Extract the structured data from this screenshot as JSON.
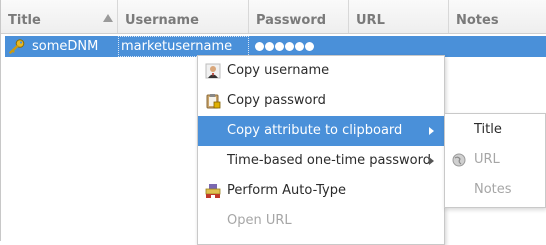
{
  "table": {
    "columns": [
      "Title",
      "Username",
      "Password",
      "URL",
      "Notes"
    ],
    "sort_column": "Title",
    "rows": [
      {
        "title": "someDNM",
        "username": "marketusername",
        "password_dots": 6,
        "url": "",
        "notes": ""
      }
    ]
  },
  "context_menu": {
    "items": [
      {
        "label": "Copy username",
        "icon": "user-icon",
        "enabled": true
      },
      {
        "label": "Copy password",
        "icon": "clipboard-lock-icon",
        "enabled": true
      },
      {
        "label": "Copy attribute to clipboard",
        "icon": "",
        "enabled": true,
        "has_submenu": true,
        "highlighted": true
      },
      {
        "label": "Time-based one-time password",
        "icon": "",
        "enabled": true,
        "has_submenu": true
      },
      {
        "label": "Perform Auto-Type",
        "icon": "auto-type-icon",
        "enabled": true
      },
      {
        "label": "Open URL",
        "icon": "",
        "enabled": false
      }
    ]
  },
  "submenu": {
    "items": [
      {
        "label": "Title",
        "enabled": true
      },
      {
        "label": "URL",
        "icon": "globe-icon",
        "enabled": false
      },
      {
        "label": "Notes",
        "enabled": false
      }
    ]
  },
  "colors": {
    "selection": "#4a90d9",
    "disabled_text": "#a6a6a6"
  }
}
